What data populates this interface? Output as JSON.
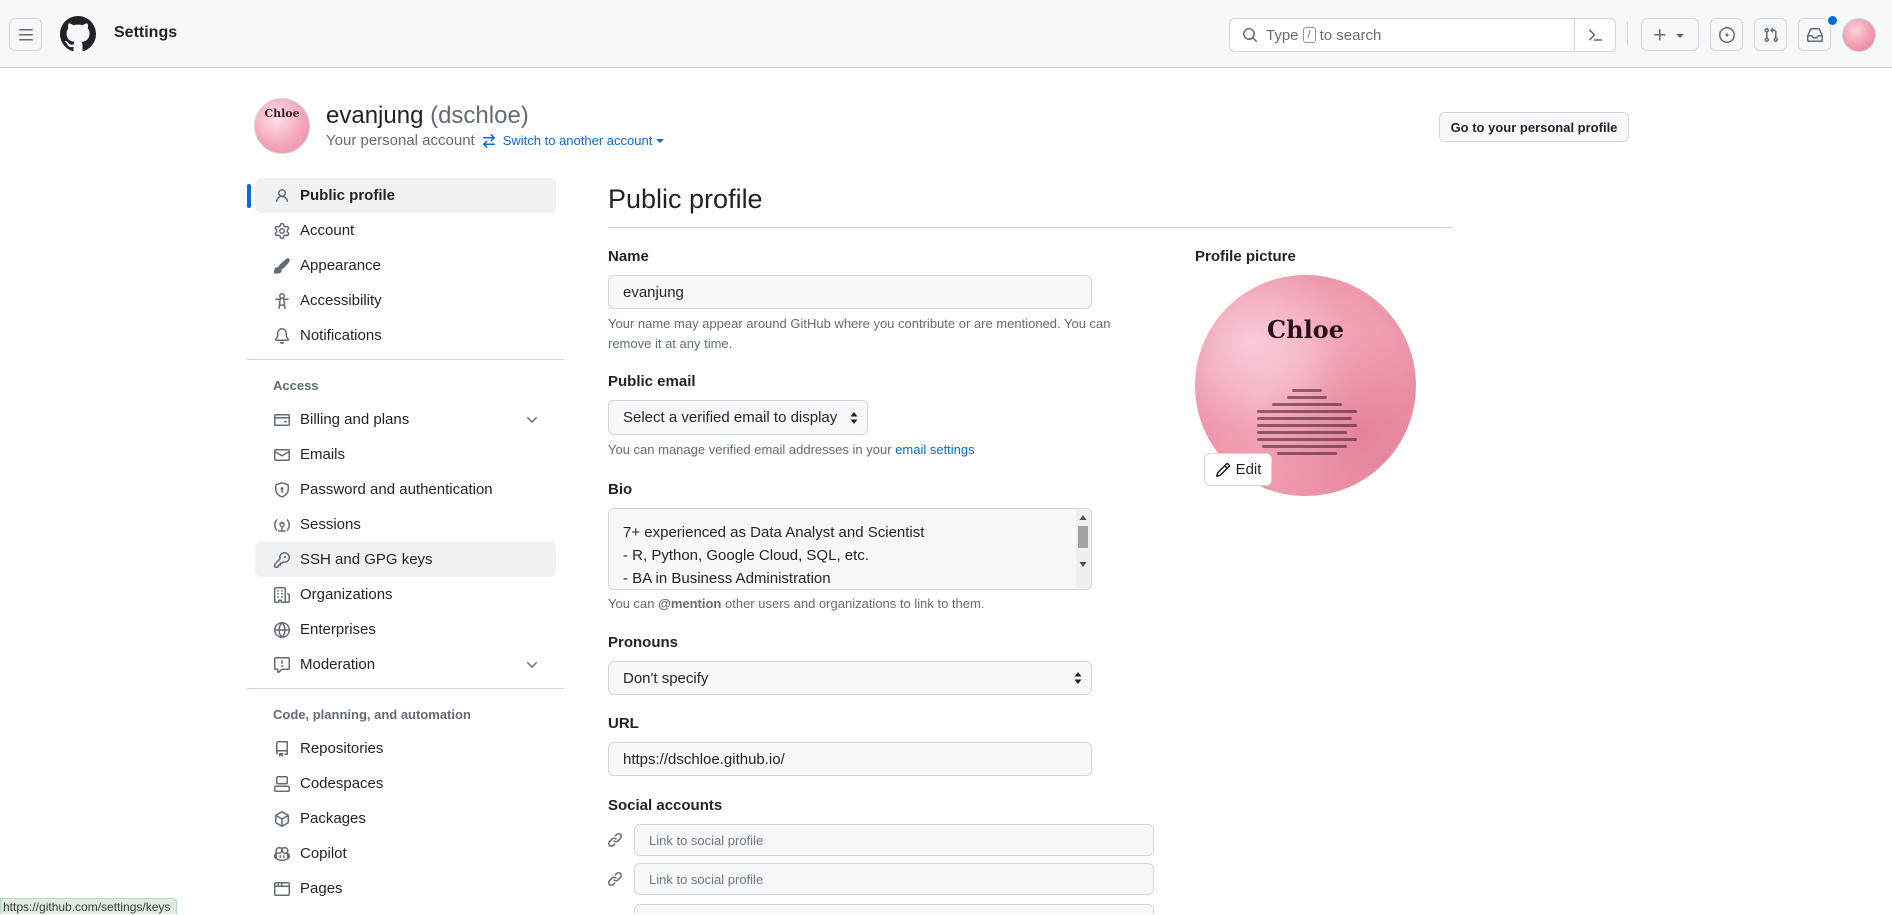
{
  "header": {
    "context_title": "Settings",
    "search": {
      "prefix": "Type",
      "key": "/",
      "suffix": "to search"
    }
  },
  "account": {
    "name": "evanjung",
    "login": "(dschloe)",
    "subtitle": "Your personal account",
    "switch_label": "Switch to another account",
    "profile_button": "Go to your personal profile"
  },
  "sidebar": {
    "items_top": [
      {
        "label": "Public profile",
        "icon": "person-icon",
        "active": true
      },
      {
        "label": "Account",
        "icon": "gear-icon"
      },
      {
        "label": "Appearance",
        "icon": "paintbrush-icon"
      },
      {
        "label": "Accessibility",
        "icon": "accessibility-icon"
      },
      {
        "label": "Notifications",
        "icon": "bell-icon"
      }
    ],
    "access_heading": "Access",
    "items_access": [
      {
        "label": "Billing and plans",
        "icon": "credit-card-icon",
        "expandable": true
      },
      {
        "label": "Emails",
        "icon": "mail-icon"
      },
      {
        "label": "Password and authentication",
        "icon": "shield-lock-icon"
      },
      {
        "label": "Sessions",
        "icon": "broadcast-icon"
      },
      {
        "label": "SSH and GPG keys",
        "icon": "key-icon",
        "hover": true
      },
      {
        "label": "Organizations",
        "icon": "organization-icon"
      },
      {
        "label": "Enterprises",
        "icon": "globe-icon"
      },
      {
        "label": "Moderation",
        "icon": "report-icon",
        "expandable": true
      }
    ],
    "code_heading": "Code, planning, and automation",
    "items_code": [
      {
        "label": "Repositories",
        "icon": "repo-icon"
      },
      {
        "label": "Codespaces",
        "icon": "codespaces-icon"
      },
      {
        "label": "Packages",
        "icon": "package-icon"
      },
      {
        "label": "Copilot",
        "icon": "copilot-icon"
      },
      {
        "label": "Pages",
        "icon": "browser-icon"
      }
    ]
  },
  "main": {
    "title": "Public profile",
    "name": {
      "label": "Name",
      "value": "evanjung",
      "note": "Your name may appear around GitHub where you contribute or are mentioned. You can remove it at any time."
    },
    "email": {
      "label": "Public email",
      "selected": "Select a verified email to display",
      "note_prefix": "You can manage verified email addresses in your",
      "note_link": "email settings"
    },
    "bio": {
      "label": "Bio",
      "lines": [
        "7+ experienced as Data Analyst and Scientist",
        "- R, Python, Google Cloud, SQL, etc.",
        "- BA in Business Administration"
      ],
      "note_prefix": "You can",
      "note_mention": "@mention",
      "note_suffix": "other users and organizations to link to them."
    },
    "pronouns": {
      "label": "Pronouns",
      "selected": "Don't specify"
    },
    "url": {
      "label": "URL",
      "value": "https://dschloe.github.io/"
    },
    "social": {
      "label": "Social accounts",
      "placeholder": "Link to social profile"
    }
  },
  "picture": {
    "label": "Profile picture",
    "edit_label": "Edit",
    "image_title": "Chloe",
    "colors": {
      "pink": "#f09db1",
      "dark": "#2a1216"
    }
  },
  "status_url": "https://github.com/settings/keys",
  "colors": {
    "accent": "#0969da",
    "border": "#d0d7de",
    "muted": "#636c76"
  }
}
